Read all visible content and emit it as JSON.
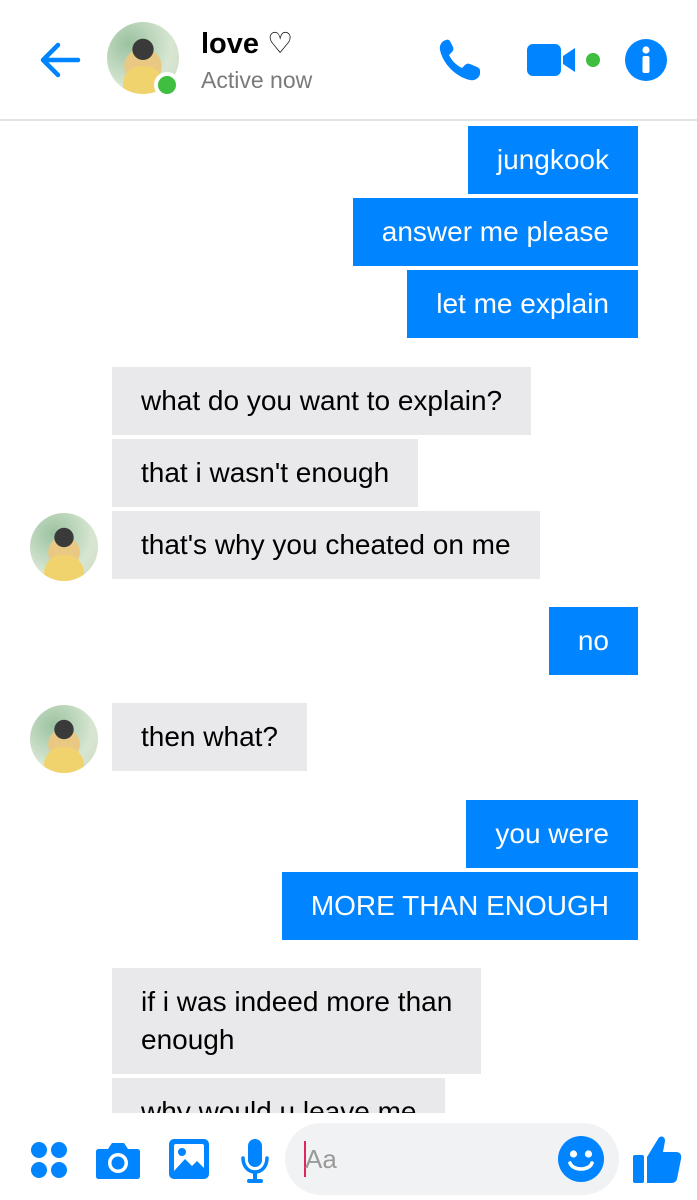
{
  "header": {
    "contact_name": "love ♡",
    "status": "Active now"
  },
  "colors": {
    "accent": "#0084ff",
    "incoming_bubble": "#e9e9eb",
    "online": "#3fbe3f"
  },
  "icons": [
    "back-arrow-icon",
    "phone-icon",
    "video-camera-icon",
    "info-icon",
    "apps-icon",
    "camera-icon",
    "gallery-icon",
    "microphone-icon",
    "emoji-icon",
    "thumbs-up-icon"
  ],
  "messages": [
    {
      "dir": "out",
      "text": "jungkook"
    },
    {
      "dir": "out",
      "text": "answer me please"
    },
    {
      "dir": "out",
      "text": "let me explain"
    },
    {
      "dir": "in",
      "text": "what do you want to explain?"
    },
    {
      "dir": "in",
      "text": "that i wasn't enough"
    },
    {
      "dir": "in",
      "text": "that's why you cheated on me"
    },
    {
      "dir": "out",
      "text": "no"
    },
    {
      "dir": "in",
      "text": "then what?"
    },
    {
      "dir": "out",
      "text": "you were"
    },
    {
      "dir": "out",
      "text": "MORE THAN ENOUGH"
    },
    {
      "dir": "in",
      "text_line1": "if i was indeed more than",
      "text_line2": "enough"
    },
    {
      "dir": "in",
      "text": "why would u leave me"
    }
  ],
  "composer": {
    "placeholder": "Aa"
  }
}
